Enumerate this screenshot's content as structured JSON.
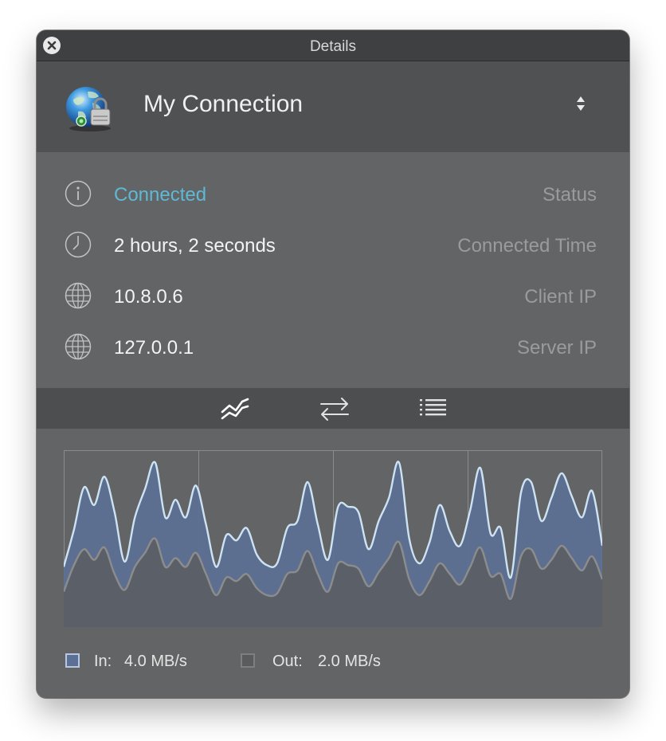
{
  "window": {
    "title": "Details"
  },
  "connection": {
    "name": "My Connection"
  },
  "info": [
    {
      "value": "Connected",
      "label": "Status",
      "icon": "info-icon"
    },
    {
      "value": "2 hours, 2 seconds",
      "label": "Connected Time",
      "icon": "clock-icon"
    },
    {
      "value": "10.8.0.6",
      "label": "Client IP",
      "icon": "globe-icon"
    },
    {
      "value": "127.0.0.1",
      "label": "Server IP",
      "icon": "globe-icon"
    }
  ],
  "tabs": [
    {
      "name": "traffic-graph",
      "icon": "graph-icon",
      "selected": true
    },
    {
      "name": "transfer",
      "icon": "arrows-icon",
      "selected": false
    },
    {
      "name": "log",
      "icon": "list-icon",
      "selected": false
    }
  ],
  "legend": {
    "in_label": "In:",
    "in_value": "4.0 MB/s",
    "out_label": "Out:",
    "out_value": "2.0 MB/s"
  },
  "colors": {
    "status_connected": "#5fb8d6",
    "in_fill": "#5b7094",
    "in_line": "#cde3f3",
    "out_line": "#8c8c8c"
  },
  "chart_data": {
    "type": "area",
    "series": [
      {
        "name": "In",
        "values": [
          0.34,
          0.55,
          0.79,
          0.69,
          0.85,
          0.65,
          0.37,
          0.62,
          0.78,
          0.93,
          0.62,
          0.72,
          0.62,
          0.8,
          0.58,
          0.34,
          0.52,
          0.49,
          0.56,
          0.41,
          0.35,
          0.36,
          0.56,
          0.6,
          0.82,
          0.58,
          0.38,
          0.68,
          0.68,
          0.65,
          0.44,
          0.6,
          0.73,
          0.93,
          0.5,
          0.36,
          0.48,
          0.69,
          0.54,
          0.46,
          0.66,
          0.9,
          0.53,
          0.56,
          0.28,
          0.76,
          0.82,
          0.6,
          0.73,
          0.87,
          0.74,
          0.62,
          0.77,
          0.46
        ]
      },
      {
        "name": "Out",
        "values": [
          0.2,
          0.35,
          0.44,
          0.38,
          0.45,
          0.3,
          0.21,
          0.34,
          0.42,
          0.5,
          0.34,
          0.39,
          0.34,
          0.42,
          0.3,
          0.18,
          0.28,
          0.26,
          0.3,
          0.22,
          0.18,
          0.19,
          0.3,
          0.32,
          0.43,
          0.3,
          0.2,
          0.36,
          0.35,
          0.33,
          0.23,
          0.31,
          0.39,
          0.48,
          0.27,
          0.18,
          0.26,
          0.36,
          0.3,
          0.24,
          0.34,
          0.45,
          0.29,
          0.3,
          0.16,
          0.4,
          0.44,
          0.33,
          0.38,
          0.46,
          0.39,
          0.32,
          0.4,
          0.27
        ]
      }
    ],
    "ylim": [
      0,
      1
    ],
    "grid": true
  }
}
